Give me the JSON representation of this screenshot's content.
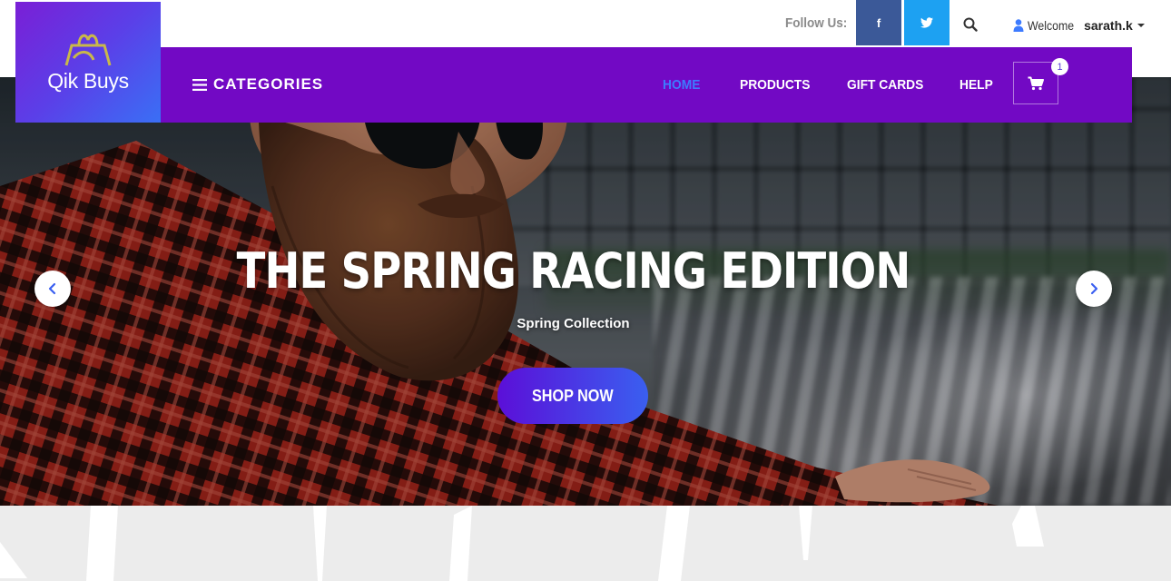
{
  "brand": {
    "name": "Qik Buys"
  },
  "topbar": {
    "follow_label": "Follow Us:",
    "social": [
      {
        "icon": "facebook-icon",
        "label": "f"
      },
      {
        "icon": "twitter-icon"
      }
    ],
    "search_icon": "search-icon",
    "user": {
      "icon": "user-icon",
      "welcome": "Welcome",
      "name": "sarath.k"
    }
  },
  "nav": {
    "categories_label": "CATEGORIES",
    "links": [
      {
        "label": "HOME",
        "active": true
      },
      {
        "label": "PRODUCTS",
        "active": false
      },
      {
        "label": "GIFT CARDS",
        "active": false
      },
      {
        "label": "HELP",
        "active": false
      }
    ],
    "cart": {
      "icon": "cart-icon",
      "count": "1"
    }
  },
  "hero": {
    "title": "THE SPRING RACING EDITION",
    "subtitle": "Spring Collection",
    "cta_label": "SHOP NOW",
    "prev_icon": "chevron-left-icon",
    "next_icon": "chevron-right-icon"
  },
  "colors": {
    "nav_bg": "#7209c4",
    "active_link": "#3d7bff",
    "facebook": "#3b5998",
    "twitter": "#1da1f2",
    "cta_gradient_start": "#5b0fd8",
    "cta_gradient_end": "#3a5ff0"
  }
}
